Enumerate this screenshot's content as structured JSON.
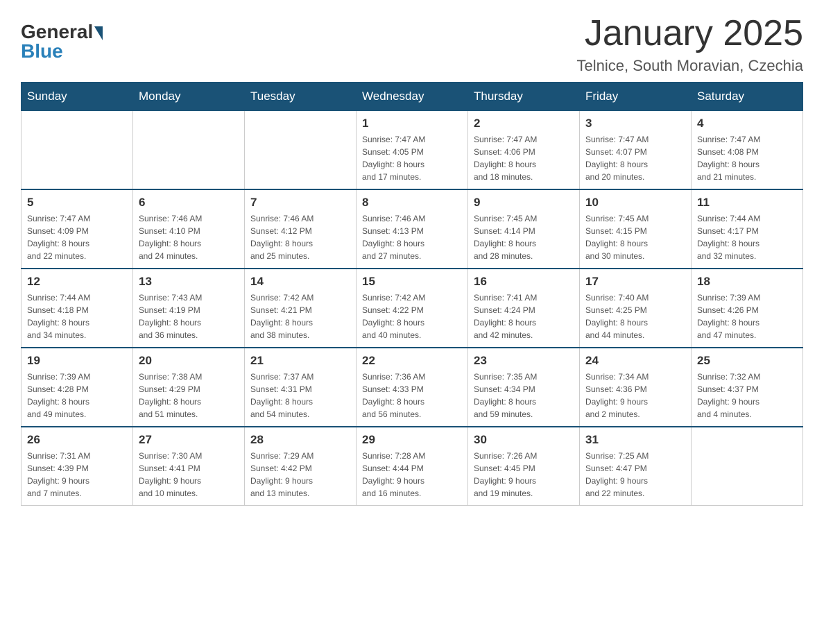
{
  "header": {
    "title": "January 2025",
    "location": "Telnice, South Moravian, Czechia",
    "logo_general": "General",
    "logo_blue": "Blue"
  },
  "days_of_week": [
    "Sunday",
    "Monday",
    "Tuesday",
    "Wednesday",
    "Thursday",
    "Friday",
    "Saturday"
  ],
  "weeks": [
    [
      {
        "day": "",
        "info": ""
      },
      {
        "day": "",
        "info": ""
      },
      {
        "day": "",
        "info": ""
      },
      {
        "day": "1",
        "info": "Sunrise: 7:47 AM\nSunset: 4:05 PM\nDaylight: 8 hours\nand 17 minutes."
      },
      {
        "day": "2",
        "info": "Sunrise: 7:47 AM\nSunset: 4:06 PM\nDaylight: 8 hours\nand 18 minutes."
      },
      {
        "day": "3",
        "info": "Sunrise: 7:47 AM\nSunset: 4:07 PM\nDaylight: 8 hours\nand 20 minutes."
      },
      {
        "day": "4",
        "info": "Sunrise: 7:47 AM\nSunset: 4:08 PM\nDaylight: 8 hours\nand 21 minutes."
      }
    ],
    [
      {
        "day": "5",
        "info": "Sunrise: 7:47 AM\nSunset: 4:09 PM\nDaylight: 8 hours\nand 22 minutes."
      },
      {
        "day": "6",
        "info": "Sunrise: 7:46 AM\nSunset: 4:10 PM\nDaylight: 8 hours\nand 24 minutes."
      },
      {
        "day": "7",
        "info": "Sunrise: 7:46 AM\nSunset: 4:12 PM\nDaylight: 8 hours\nand 25 minutes."
      },
      {
        "day": "8",
        "info": "Sunrise: 7:46 AM\nSunset: 4:13 PM\nDaylight: 8 hours\nand 27 minutes."
      },
      {
        "day": "9",
        "info": "Sunrise: 7:45 AM\nSunset: 4:14 PM\nDaylight: 8 hours\nand 28 minutes."
      },
      {
        "day": "10",
        "info": "Sunrise: 7:45 AM\nSunset: 4:15 PM\nDaylight: 8 hours\nand 30 minutes."
      },
      {
        "day": "11",
        "info": "Sunrise: 7:44 AM\nSunset: 4:17 PM\nDaylight: 8 hours\nand 32 minutes."
      }
    ],
    [
      {
        "day": "12",
        "info": "Sunrise: 7:44 AM\nSunset: 4:18 PM\nDaylight: 8 hours\nand 34 minutes."
      },
      {
        "day": "13",
        "info": "Sunrise: 7:43 AM\nSunset: 4:19 PM\nDaylight: 8 hours\nand 36 minutes."
      },
      {
        "day": "14",
        "info": "Sunrise: 7:42 AM\nSunset: 4:21 PM\nDaylight: 8 hours\nand 38 minutes."
      },
      {
        "day": "15",
        "info": "Sunrise: 7:42 AM\nSunset: 4:22 PM\nDaylight: 8 hours\nand 40 minutes."
      },
      {
        "day": "16",
        "info": "Sunrise: 7:41 AM\nSunset: 4:24 PM\nDaylight: 8 hours\nand 42 minutes."
      },
      {
        "day": "17",
        "info": "Sunrise: 7:40 AM\nSunset: 4:25 PM\nDaylight: 8 hours\nand 44 minutes."
      },
      {
        "day": "18",
        "info": "Sunrise: 7:39 AM\nSunset: 4:26 PM\nDaylight: 8 hours\nand 47 minutes."
      }
    ],
    [
      {
        "day": "19",
        "info": "Sunrise: 7:39 AM\nSunset: 4:28 PM\nDaylight: 8 hours\nand 49 minutes."
      },
      {
        "day": "20",
        "info": "Sunrise: 7:38 AM\nSunset: 4:29 PM\nDaylight: 8 hours\nand 51 minutes."
      },
      {
        "day": "21",
        "info": "Sunrise: 7:37 AM\nSunset: 4:31 PM\nDaylight: 8 hours\nand 54 minutes."
      },
      {
        "day": "22",
        "info": "Sunrise: 7:36 AM\nSunset: 4:33 PM\nDaylight: 8 hours\nand 56 minutes."
      },
      {
        "day": "23",
        "info": "Sunrise: 7:35 AM\nSunset: 4:34 PM\nDaylight: 8 hours\nand 59 minutes."
      },
      {
        "day": "24",
        "info": "Sunrise: 7:34 AM\nSunset: 4:36 PM\nDaylight: 9 hours\nand 2 minutes."
      },
      {
        "day": "25",
        "info": "Sunrise: 7:32 AM\nSunset: 4:37 PM\nDaylight: 9 hours\nand 4 minutes."
      }
    ],
    [
      {
        "day": "26",
        "info": "Sunrise: 7:31 AM\nSunset: 4:39 PM\nDaylight: 9 hours\nand 7 minutes."
      },
      {
        "day": "27",
        "info": "Sunrise: 7:30 AM\nSunset: 4:41 PM\nDaylight: 9 hours\nand 10 minutes."
      },
      {
        "day": "28",
        "info": "Sunrise: 7:29 AM\nSunset: 4:42 PM\nDaylight: 9 hours\nand 13 minutes."
      },
      {
        "day": "29",
        "info": "Sunrise: 7:28 AM\nSunset: 4:44 PM\nDaylight: 9 hours\nand 16 minutes."
      },
      {
        "day": "30",
        "info": "Sunrise: 7:26 AM\nSunset: 4:45 PM\nDaylight: 9 hours\nand 19 minutes."
      },
      {
        "day": "31",
        "info": "Sunrise: 7:25 AM\nSunset: 4:47 PM\nDaylight: 9 hours\nand 22 minutes."
      },
      {
        "day": "",
        "info": ""
      }
    ]
  ]
}
